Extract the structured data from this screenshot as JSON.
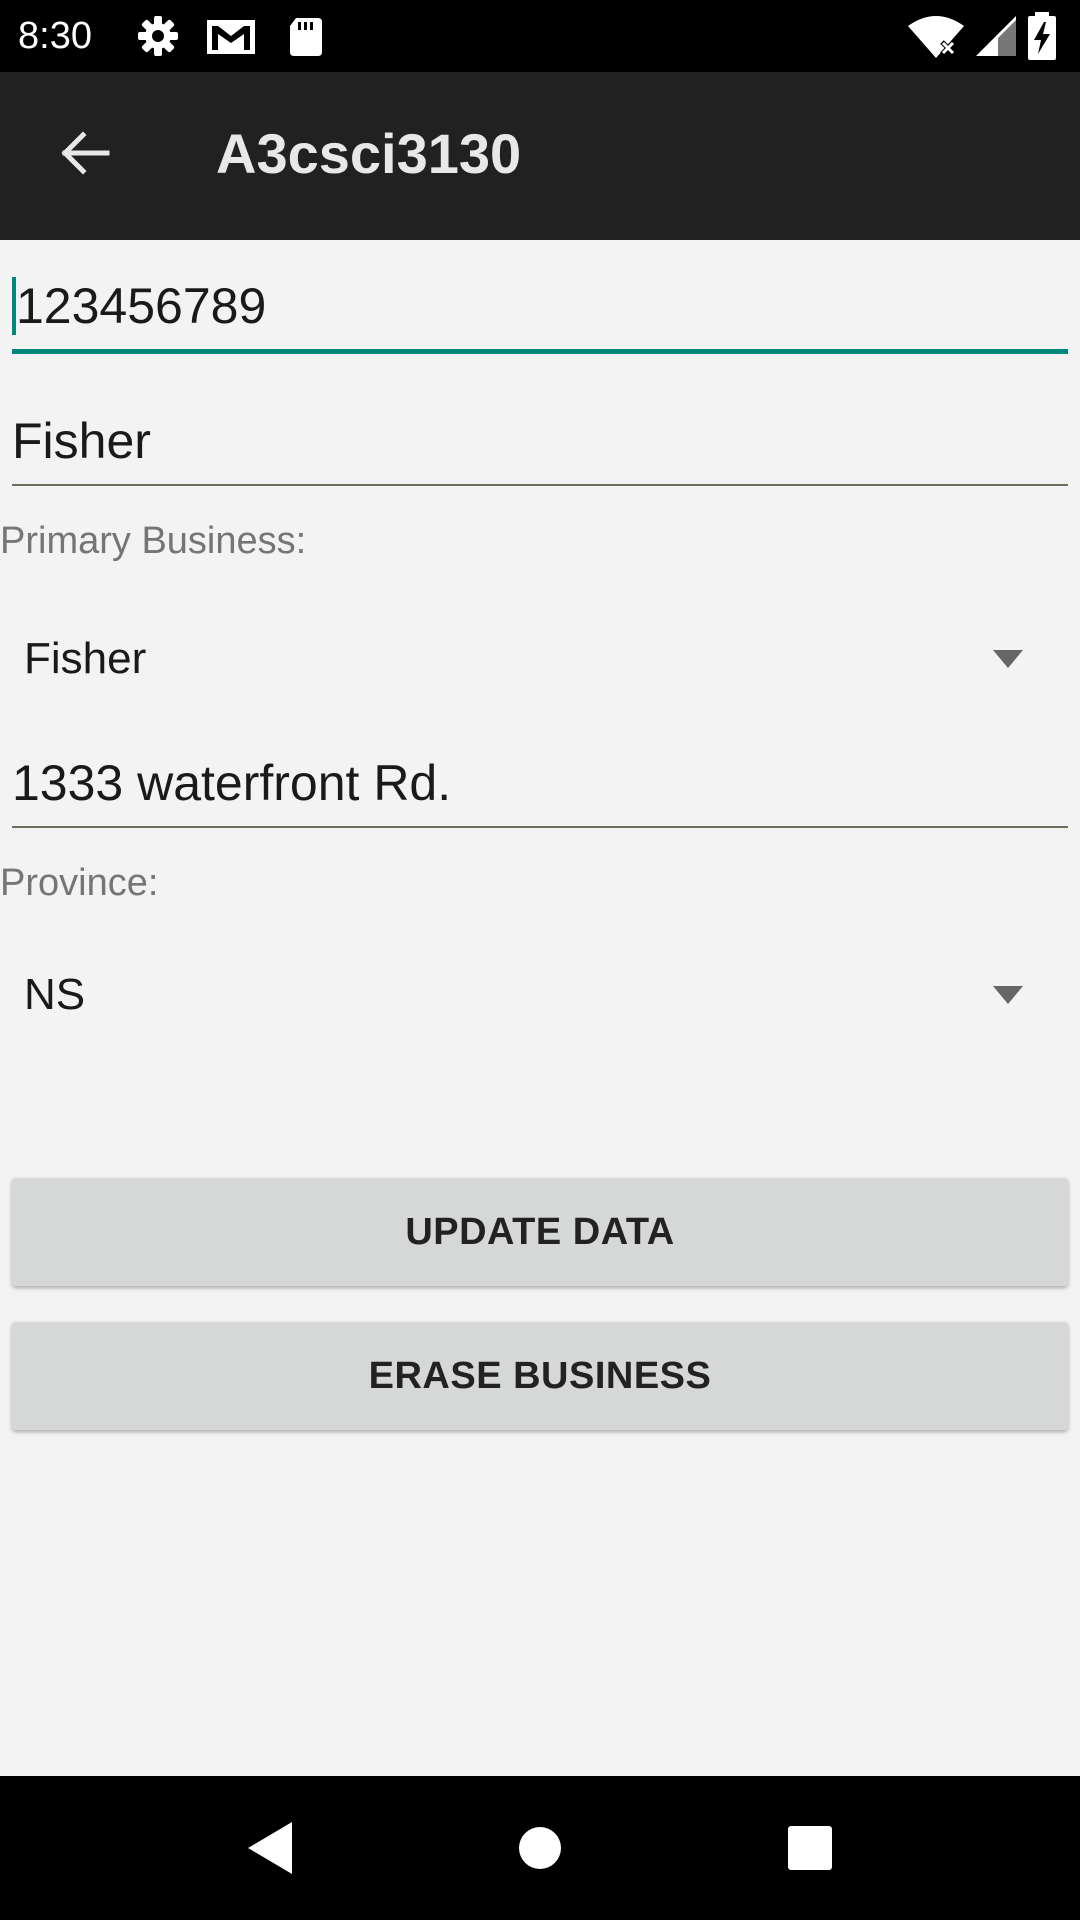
{
  "status_bar": {
    "time": "8:30",
    "icons": [
      "gear-icon",
      "gmail-icon",
      "sd-card-icon",
      "wifi-icon",
      "signal-icon",
      "battery-charging-icon"
    ]
  },
  "app_bar": {
    "title": "A3csci3130",
    "back_icon": "back-arrow-icon"
  },
  "form": {
    "id_field": {
      "value": "123456789"
    },
    "name_field": {
      "value": "Fisher"
    },
    "primary_business": {
      "label": "Primary Business:",
      "selected": "Fisher"
    },
    "address_field": {
      "value": "1333 waterfront Rd."
    },
    "province": {
      "label": "Province:",
      "selected": "NS"
    }
  },
  "buttons": {
    "update": "UPDATE DATA",
    "erase": "ERASE BUSINESS"
  },
  "colors": {
    "accent": "#00897b",
    "app_bar": "#212121",
    "button": "#d6d7d7"
  },
  "nav_bar": {
    "icons": [
      "back-triangle-icon",
      "home-circle-icon",
      "recents-square-icon"
    ]
  }
}
